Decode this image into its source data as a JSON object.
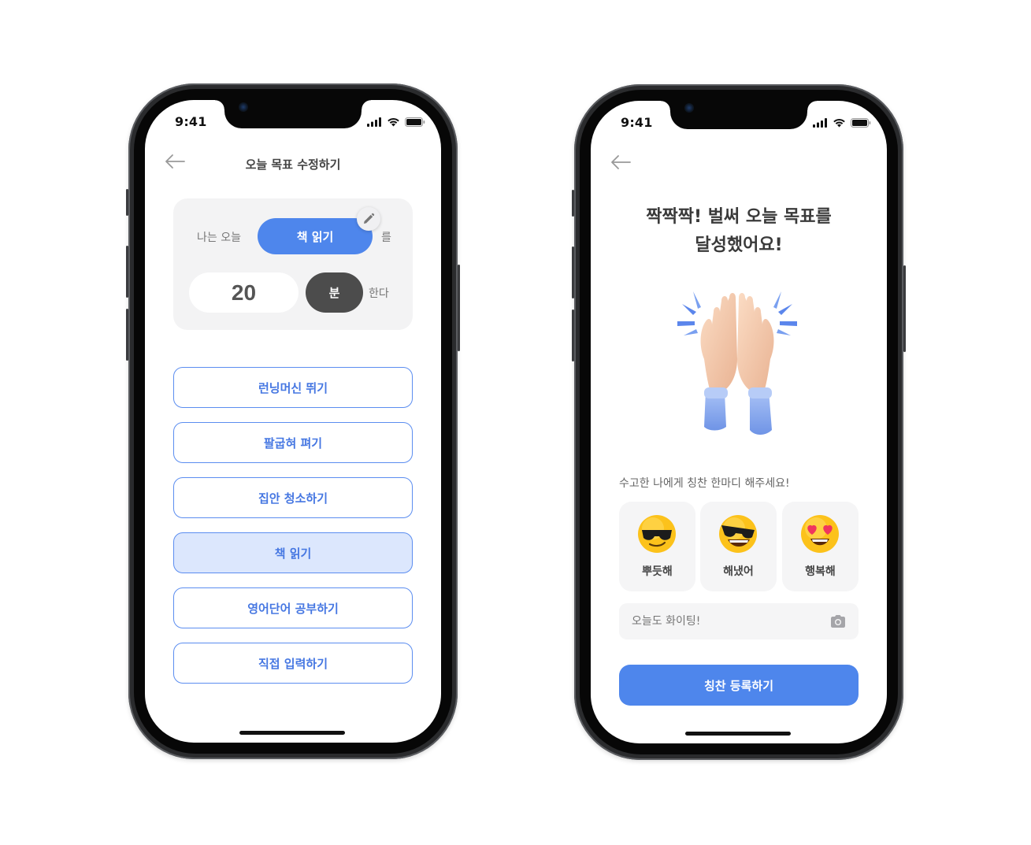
{
  "screen1": {
    "status": {
      "time": "9:41"
    },
    "nav": {
      "title": "오늘 목표 수정하기",
      "back_icon": "arrow-left-icon"
    },
    "goal": {
      "prefix": "나는 오늘",
      "activity": "책 읽기",
      "particle": "를",
      "amount": "20",
      "unit": "분",
      "suffix": "한다",
      "edit_icon": "pencil-icon"
    },
    "options": [
      {
        "label": "런닝머신 뛰기",
        "selected": false
      },
      {
        "label": "팔굽혀 펴기",
        "selected": false
      },
      {
        "label": "집안 청소하기",
        "selected": false
      },
      {
        "label": "책 읽기",
        "selected": true
      },
      {
        "label": "영어단어 공부하기",
        "selected": false
      },
      {
        "label": "직접 입력하기",
        "selected": false
      }
    ]
  },
  "screen2": {
    "status": {
      "time": "9:41"
    },
    "nav": {
      "back_icon": "arrow-left-icon"
    },
    "headline": {
      "line1": "짝짝짝! 벌써 오늘 목표를",
      "line2": "달성했어요!"
    },
    "illustration": "high-five-hands-icon",
    "prompt": "수고한 나에게 칭찬 한마디 해주세요!",
    "emojis": [
      {
        "label": "뿌듯해",
        "icon": "smug-sunglasses-face-icon"
      },
      {
        "label": "해냈어",
        "icon": "grinning-sunglasses-face-icon"
      },
      {
        "label": "행복해",
        "icon": "heart-eyes-face-icon"
      }
    ],
    "input": {
      "placeholder": "오늘도 화이팅!",
      "camera_icon": "camera-icon"
    },
    "submit": "칭찬 등록하기"
  },
  "colors": {
    "accent": "#4e86ec",
    "selected_bg": "#dce7fd",
    "dark_pill": "#4c4c4c",
    "card_bg": "#f3f3f4"
  }
}
